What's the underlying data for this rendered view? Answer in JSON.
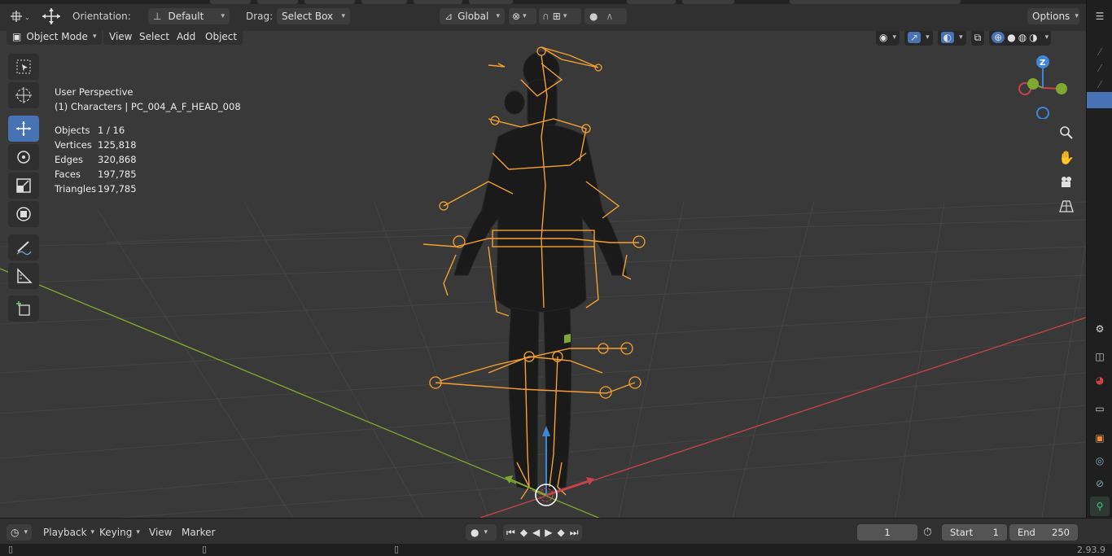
{
  "header": {
    "orientation_label": "Orientation:",
    "orientation_value": "Default",
    "drag_label": "Drag:",
    "drag_value": "Select Box",
    "transform_space": "Global",
    "options_label": "Options"
  },
  "viewport_menu": {
    "mode": "Object Mode",
    "items": [
      "View",
      "Select",
      "Add",
      "Object"
    ]
  },
  "overlay": {
    "perspective": "User Perspective",
    "context": "(1) Characters | PC_004_A_F_HEAD_008",
    "stats": [
      {
        "label": "Objects",
        "value": "1 / 16"
      },
      {
        "label": "Vertices",
        "value": "125,818"
      },
      {
        "label": "Edges",
        "value": "320,868"
      },
      {
        "label": "Faces",
        "value": "197,785"
      },
      {
        "label": "Triangles",
        "value": "197,785"
      }
    ]
  },
  "gizmo": {
    "z_label": "Z"
  },
  "timeline": {
    "menus": [
      "Playback",
      "Keying",
      "View",
      "Marker"
    ],
    "current_frame": "1",
    "start_label": "Start",
    "start_value": "1",
    "end_label": "End",
    "end_value": "250"
  },
  "status": {
    "version": "2.93.9"
  },
  "colors": {
    "accent": "#4772b3",
    "armature": "#f5a030",
    "axis_x": "#c8424c",
    "axis_y": "#7fa830",
    "axis_z": "#3f87d6"
  }
}
